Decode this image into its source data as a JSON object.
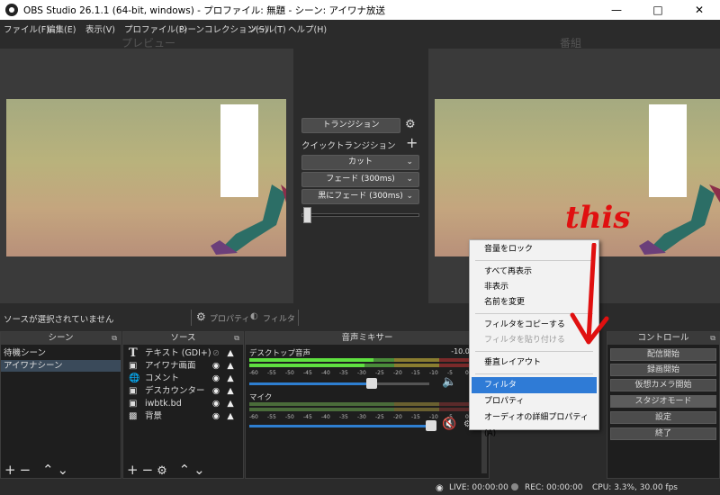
{
  "window": {
    "title": "OBS Studio 26.1.1 (64-bit, windows) - プロファイル: 無題 - シーン: アイワナ放送"
  },
  "menu": [
    "ファイル(F)",
    "編集(E)",
    "表示(V)",
    "プロファイル(P)",
    "シーンコレクション(S)",
    "ツール(T)",
    "ヘルプ(H)"
  ],
  "preview_label": "プレビュー",
  "program_label": "番組",
  "transition": {
    "button": "トランジション",
    "quick": "クイックトランジション",
    "items": [
      "カット",
      "フェード (300ms)",
      "黒にフェード (300ms)"
    ]
  },
  "source_bar": {
    "no_source": "ソースが選択されていません",
    "properties": "プロパティ",
    "filters": "フィルタ"
  },
  "scenes": {
    "title": "シーン",
    "items": [
      "待機シーン",
      "アイワナシーン"
    ],
    "selected": 1
  },
  "sources": {
    "title": "ソース",
    "items": [
      {
        "label": "テキスト (GDI+)",
        "icon": "text-icon",
        "visible": false
      },
      {
        "label": "アイワナ画面",
        "icon": "window-icon",
        "visible": true
      },
      {
        "label": "コメント",
        "icon": "globe-icon",
        "visible": true
      },
      {
        "label": "デスカウンター",
        "icon": "window-icon",
        "visible": true
      },
      {
        "label": "iwbtk.bd",
        "icon": "window-icon",
        "visible": true
      },
      {
        "label": "背景",
        "icon": "image-icon",
        "visible": true
      }
    ]
  },
  "mixer": {
    "title": "音声ミキサー",
    "channels": [
      {
        "name": "デスクトップ音声",
        "db": "-10.0 dB",
        "level": 0.75,
        "muted": false
      },
      {
        "name": "マイク",
        "db": "",
        "level": 0.95,
        "muted": true
      }
    ],
    "ticks": [
      "-60",
      "-55",
      "-50",
      "-45",
      "-40",
      "-35",
      "-30",
      "-25",
      "-20",
      "-15",
      "-10",
      "-5",
      "0"
    ]
  },
  "controls": {
    "title": "コントロール",
    "buttons": [
      "配信開始",
      "録画開始",
      "仮想カメラ開始",
      "スタジオモード",
      "設定",
      "終了"
    ]
  },
  "context_menu": {
    "items": [
      {
        "label": "音量をロック",
        "state": "normal"
      },
      {
        "label": "すべて再表示",
        "state": "normal"
      },
      {
        "label": "非表示",
        "state": "normal"
      },
      {
        "label": "名前を変更",
        "state": "normal"
      },
      {
        "label": "フィルタをコピーする",
        "state": "normal"
      },
      {
        "label": "フィルタを貼り付ける",
        "state": "disabled"
      },
      {
        "label": "垂直レイアウト",
        "state": "normal"
      },
      {
        "label": "フィルタ",
        "state": "highlighted"
      },
      {
        "label": "プロパティ",
        "state": "normal"
      },
      {
        "label": "オーディオの詳細プロパティ(A)",
        "state": "normal"
      }
    ]
  },
  "status": {
    "live": "LIVE: 00:00:00",
    "rec": "REC: 00:00:00",
    "cpu": "CPU: 3.3%, 30.00 fps"
  },
  "annotation": "this",
  "colors": {
    "highlight": "#2f7bd6",
    "annotation": "#e01010",
    "mute": "#d83030"
  }
}
